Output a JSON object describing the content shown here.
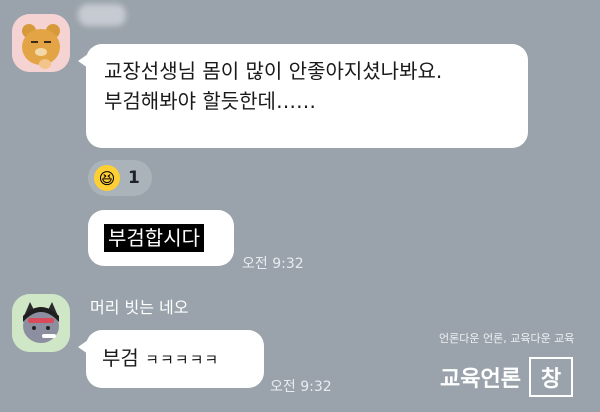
{
  "messages": [
    {
      "lines": [
        "교장선생님 몸이 많이 안좋아지셨나봐요.",
        "부검해봐야 할듯한데……"
      ],
      "reaction": {
        "icon": "laughing-emoji-icon",
        "count": "1"
      }
    },
    {
      "text": "부검합시다",
      "time": "오전 9:32"
    }
  ],
  "second_sender": {
    "name": "머리 빗는 네오",
    "message_main": "부검",
    "message_suffix": "ㅋㅋㅋㅋㅋ",
    "time": "오전 9:32"
  },
  "watermark": {
    "tagline": "언론다운 언론, 교육다운 교육",
    "brand": "교육언론",
    "brand_box": "창"
  }
}
